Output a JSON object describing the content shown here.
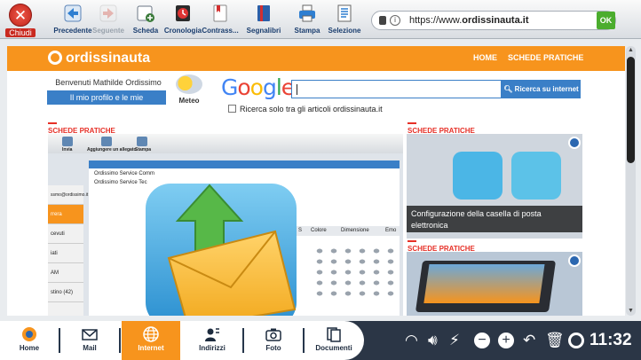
{
  "toolbar": {
    "close_label": "Chiudi",
    "buttons": [
      {
        "label": "Precedente",
        "icon": "back-arrow-icon",
        "enabled": true
      },
      {
        "label": "Seguente",
        "icon": "forward-arrow-icon",
        "enabled": false
      },
      {
        "label": "Scheda",
        "icon": "new-tab-icon",
        "enabled": true
      },
      {
        "label": "Cronologia",
        "icon": "history-icon",
        "enabled": true
      },
      {
        "label": "Contrass...",
        "icon": "bookmark-add-icon",
        "enabled": true
      },
      {
        "label": "Segnalibri",
        "icon": "bookmarks-icon",
        "enabled": true
      },
      {
        "label": "Stampa",
        "icon": "print-icon",
        "enabled": true
      },
      {
        "label": "Selezione",
        "icon": "selection-icon",
        "enabled": true
      }
    ],
    "url_prefix": "https://www.",
    "url_domain": "ordissinauta.it",
    "ok_label": "OK"
  },
  "site": {
    "logo_text": "ordissinauta",
    "nav": [
      "HOME",
      "SCHEDE PRATICHE"
    ],
    "welcome": "Benvenuti Mathilde Ordissimo",
    "profile_link": "Il mio profilo e le mie pubblicazioni",
    "weather_label": "Meteo",
    "google_logo": "Google",
    "search_button": "Ricerca su internet",
    "search_checkbox_label": "Ricerca solo tra gli articoli ordissinauta.it",
    "section_main_title": "SCHEDE PRATICHE",
    "section_aside_title1": "SCHEDE PRATICHE",
    "section_aside_title2": "SCHEDE PRATICHE",
    "aside_caption": "Configurazione della casella di posta elettronica",
    "main_card": {
      "toolbar_labels": [
        "Invia",
        "Aggiungere un allegato",
        "Stampa"
      ],
      "header_line1": "Ordissimo Service Comm",
      "header_line2": "Ordissimo Service Tec",
      "sidebar": [
        "ssmo@ordissimo.it",
        "rrera",
        "cevuti",
        "iati",
        "AM",
        "stino (42)"
      ],
      "tabs": [
        "S",
        "Colore",
        "Dimensione",
        "Emo"
      ]
    }
  },
  "dock": {
    "items": [
      {
        "label": "Home",
        "icon": "home-icon"
      },
      {
        "label": "Mail",
        "icon": "mail-icon"
      },
      {
        "label": "Internet",
        "icon": "globe-icon",
        "active": true
      },
      {
        "label": "Indirizzi",
        "icon": "contacts-icon"
      },
      {
        "label": "Foto",
        "icon": "camera-icon"
      },
      {
        "label": "Documenti",
        "icon": "documents-icon"
      }
    ],
    "clock": "11:32"
  },
  "colors": {
    "brand_orange": "#f7941d",
    "link_blue": "#3a7fc7",
    "section_red": "#e63027",
    "dock_dark": "#2b3646"
  }
}
